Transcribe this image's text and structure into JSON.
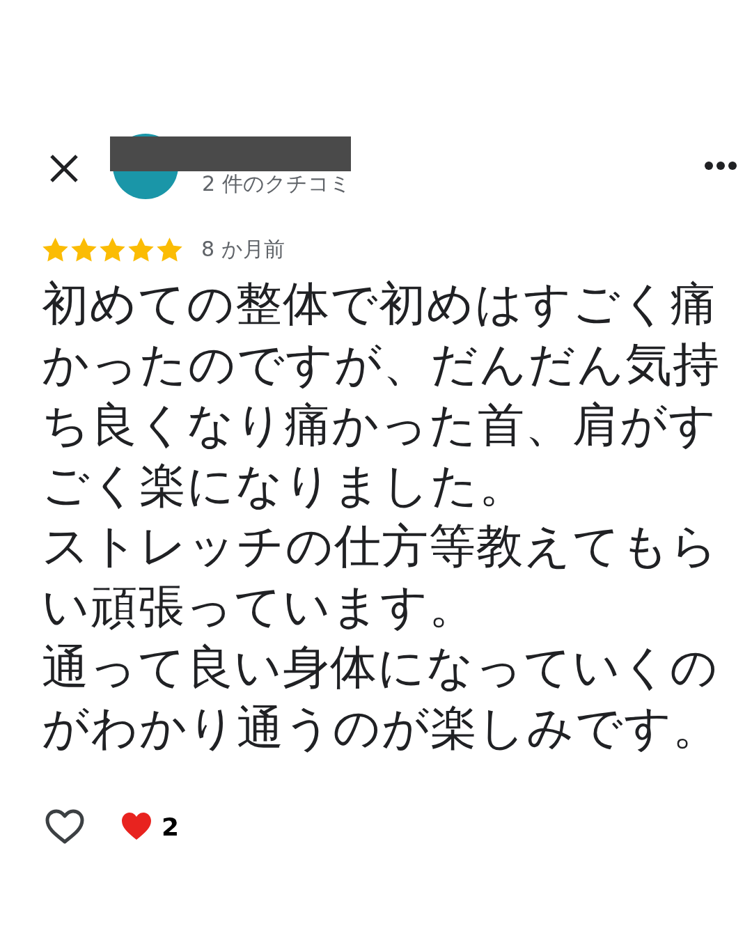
{
  "header": {
    "review_count": "2 件のクチコミ",
    "name_redacted": true
  },
  "review": {
    "stars": 5,
    "time": "8 か月前",
    "paragraphs": [
      "初めての整体で初めはすごく痛かったのですが、だんだん気持ち良くなり痛かった首、肩がすごく楽になりました。",
      "ストレッチの仕方等教えてもらい頑張っています。",
      "通って良い身体になっていくのがわかり通うのが楽しみです。"
    ]
  },
  "reactions": {
    "count": "2"
  }
}
